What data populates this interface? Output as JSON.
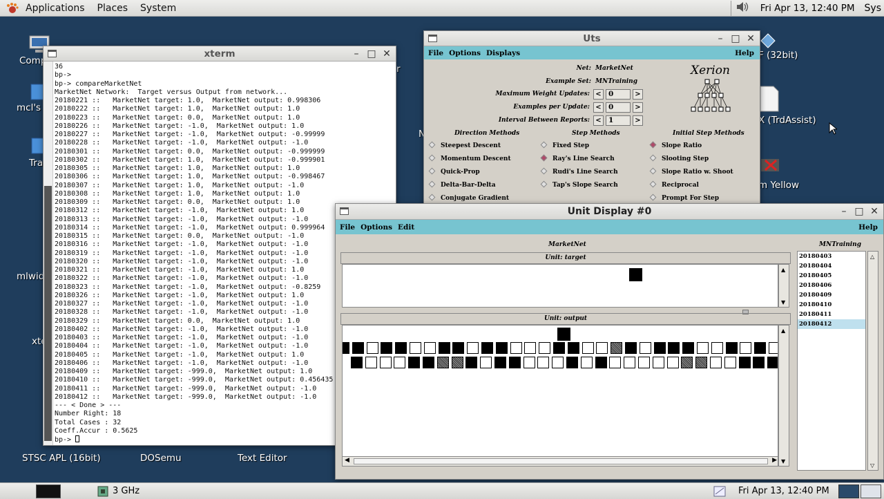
{
  "top_panel": {
    "menus": [
      "Applications",
      "Places",
      "System"
    ],
    "clock": "Fri Apr 13, 12:40 PM",
    "user": "Sys"
  },
  "desktop_icons": {
    "computer": "Comp",
    "home": "mcl's",
    "trash": "Tra",
    "mlwid": "mlwid",
    "xterm": "xte",
    "stsc": "STSC APL (16bit)",
    "dosemu": "DOSemu",
    "text_editor": "Text Editor",
    "bit32": "F (32bit)",
    "trdassist": "X (TrdAssist)",
    "yellow": "m Yellow",
    "r_partial": "r",
    "n_partial": "N"
  },
  "xterm": {
    "title": "xterm",
    "lines": [
      "36",
      "bp->",
      "bp-> compareMarketNet",
      "MarketNet Network:  Target versus Output from network...",
      "20180221 ::   MarketNet target: 1.0,  MarketNet output: 0.998306",
      "20180222 ::   MarketNet target: 1.0,  MarketNet output: 1.0",
      "20180223 ::   MarketNet target: 0.0,  MarketNet output: 1.0",
      "20180226 ::   MarketNet target: -1.0,  MarketNet output: 1.0",
      "20180227 ::   MarketNet target: -1.0,  MarketNet output: -0.99999",
      "20180228 ::   MarketNet target: -1.0,  MarketNet output: -1.0",
      "20180301 ::   MarketNet target: 0.0,  MarketNet output: -0.999999",
      "20180302 ::   MarketNet target: 1.0,  MarketNet output: -0.999901",
      "20180305 ::   MarketNet target: 1.0,  MarketNet output: 1.0",
      "20180306 ::   MarketNet target: 1.0,  MarketNet output: -0.998467",
      "20180307 ::   MarketNet target: 1.0,  MarketNet output: -1.0",
      "20180308 ::   MarketNet target: 1.0,  MarketNet output: 1.0",
      "20180309 ::   MarketNet target: 0.0,  MarketNet output: 1.0",
      "20180312 ::   MarketNet target: -1.0,  MarketNet output: 1.0",
      "20180313 ::   MarketNet target: -1.0,  MarketNet output: -1.0",
      "20180314 ::   MarketNet target: -1.0,  MarketNet output: 0.999964",
      "20180315 ::   MarketNet target: 0.0,  MarketNet output: -1.0",
      "20180316 ::   MarketNet target: -1.0,  MarketNet output: -1.0",
      "20180319 ::   MarketNet target: -1.0,  MarketNet output: -1.0",
      "20180320 ::   MarketNet target: -1.0,  MarketNet output: -1.0",
      "20180321 ::   MarketNet target: -1.0,  MarketNet output: 1.0",
      "20180322 ::   MarketNet target: -1.0,  MarketNet output: -1.0",
      "20180323 ::   MarketNet target: -1.0,  MarketNet output: -0.8259",
      "20180326 ::   MarketNet target: -1.0,  MarketNet output: 1.0",
      "20180327 ::   MarketNet target: -1.0,  MarketNet output: -1.0",
      "20180328 ::   MarketNet target: -1.0,  MarketNet output: -1.0",
      "20180329 ::   MarketNet target: 0.0,  MarketNet output: 1.0",
      "20180402 ::   MarketNet target: -1.0,  MarketNet output: -1.0",
      "20180403 ::   MarketNet target: -1.0,  MarketNet output: -1.0",
      "20180404 ::   MarketNet target: -1.0,  MarketNet output: -1.0",
      "20180405 ::   MarketNet target: -1.0,  MarketNet output: 1.0",
      "20180406 ::   MarketNet target: -1.0,  MarketNet output: -1.0",
      "20180409 ::   MarketNet target: -999.0,  MarketNet output: 1.0",
      "20180410 ::   MarketNet target: -999.0,  MarketNet output: 0.456435",
      "20180411 ::   MarketNet target: -999.0,  MarketNet output: -1.0",
      "20180412 ::   MarketNet target: -999.0,  MarketNet output: -1.0",
      "--- < Done > ---",
      "Number Right: 18",
      "Total Cases : 32",
      "Coeff.Accur : 0.5625"
    ],
    "prompt": "bp-> "
  },
  "uts": {
    "title": "Uts",
    "menu": [
      "File",
      "Options",
      "Displays"
    ],
    "help": "Help",
    "net_label": "Net:",
    "net_value": "MarketNet",
    "example_set_label": "Example Set:",
    "example_set_value": "MNTraining",
    "max_weight_label": "Maximum Weight Updates:",
    "max_weight_value": "0",
    "examples_per_update_label": "Examples per Update:",
    "examples_per_update_value": "0",
    "interval_label": "Interval Between Reports:",
    "interval_value": "1",
    "logo": "Xerion",
    "direction_head": "Direction Methods",
    "step_head": "Step Methods",
    "initial_head": "Initial Step Methods",
    "direction": [
      "Steepest Descent",
      "Momentum Descent",
      "Quick-Prop",
      "Delta-Bar-Delta",
      "Conjugate Gradient"
    ],
    "step": [
      "Fixed Step",
      "Ray's Line Search",
      "Rudi's Line Search",
      "Tap's Slope Search"
    ],
    "initial": [
      "Slope Ratio",
      "Slooting Step",
      "Slope Ratio w. Shoot",
      "Reciprocal",
      "Prompt For Step"
    ],
    "step_selected": "Ray's Line Search",
    "initial_selected": "Slope Ratio"
  },
  "unit_display": {
    "title": "Unit Display #0",
    "menu": [
      "File",
      "Options",
      "Edit"
    ],
    "help": "Help",
    "net_name": "MarketNet",
    "target_label": "Unit: target",
    "output_label": "Unit: output",
    "list_title": "MNTraining",
    "list_items": [
      "20180403",
      "20180404",
      "20180405",
      "20180406",
      "20180409",
      "20180410",
      "20180411",
      "20180412"
    ],
    "selected_item": "20180412",
    "output_row1": "bbwbbwwbbwbbwwwbbwwgbwbbbwwbwbww",
    "output_row2": "bwwwbbggbwbbwwwbwbwwwwwggwwbbbwgbb"
  },
  "bottom_panel": {
    "cpu": "3 GHz",
    "clock": "Fri Apr 13, 12:40 PM"
  }
}
